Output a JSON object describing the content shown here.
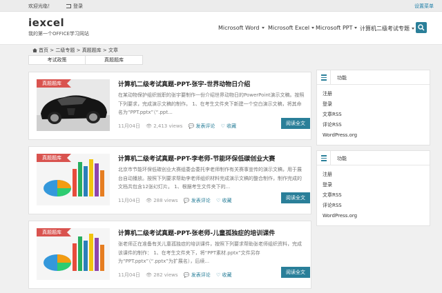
{
  "topbar": {
    "welcome": "欢迎光临！",
    "login": "登录",
    "settings": "设置菜单"
  },
  "header": {
    "logo": "iexcel",
    "slogan": "我的第一个OFFICE学习网站",
    "nav": [
      "Microsoft Word",
      "Microsoft Excel",
      "Microsoft PPT",
      "计算机二级考试专题"
    ]
  },
  "breadcrumb": {
    "home": "首页",
    "sep": ">",
    "items": [
      "二级专题",
      "真题题库",
      "文章"
    ]
  },
  "tags": [
    "考试政策",
    "真题题库"
  ],
  "articles": [
    {
      "ribbon": "真题题库",
      "title": "计算机二级考试真题-PPT-张宇-世界动物日介绍",
      "excerpt": "在某动物保护组织就职的张宇要制作一份介绍世界动物日的PowerPoint演示文稿。按照下列要求，完成演示文稿的制作。 1、在考生文件夹下新建一个空白演示文稿，将其命名为“PPT.pptx”（“.ppt...",
      "date": "11月04日",
      "views": "2,413 views",
      "comment": "发表评论",
      "fav": "收藏",
      "read": "阅读全文"
    },
    {
      "ribbon": "真题题库",
      "title": "计算机二级考试真题-PPT-李老师-节能环保低碳创业大赛",
      "excerpt": "北京市节能环保低碳创业大赛组委会委托李老师制作有关赛事宣传的演示文稿，用于展台自动播放。按照下列要求帮助李老师组织材料完成演示文稿的整合制作，制作完成的文档共包含12张幻灯片。 1、根据考生文件夹下的...",
      "date": "11月04日",
      "views": "288 views",
      "comment": "发表评论",
      "fav": "收藏",
      "read": "阅读全文"
    },
    {
      "ribbon": "真题题库",
      "title": "计算机二级考试真题-PPT-张老师-儿童孤独症的培训课件",
      "excerpt": "张老师正在准备有关儿童孤独症的培训课件，按照下列要求帮助张老师组织资料，完成该课件的制作： 1、在考生文件夹下，将“PPT素材.pptx”文件另存为“PPT.pptx”（“.pptx”为扩展名），后续...",
      "date": "11月04日",
      "views": "282 views",
      "comment": "发表评论",
      "fav": "收藏",
      "read": "阅读全文"
    }
  ],
  "widgets": [
    {
      "title": "功能",
      "items": [
        "注册",
        "登录",
        "文章RSS",
        "评论RSS",
        "WordPress.org"
      ]
    },
    {
      "title": "功能",
      "items": [
        "注册",
        "登录",
        "文章RSS",
        "评论RSS",
        "WordPress.org"
      ]
    }
  ],
  "colors": {
    "accent": "#2a7f99",
    "ribbon": "#d9534f"
  }
}
